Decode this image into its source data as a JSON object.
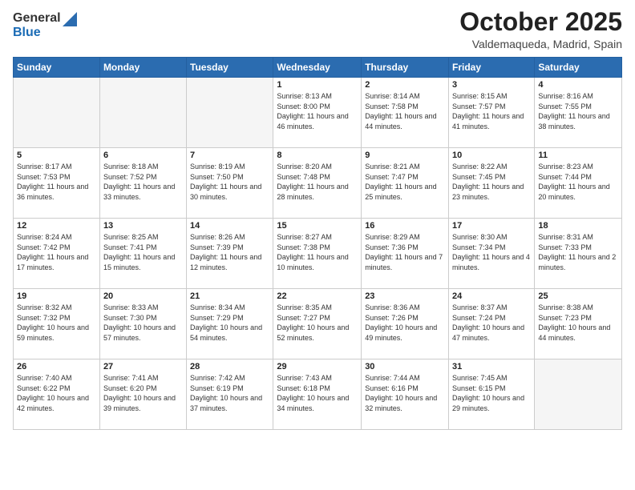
{
  "logo": {
    "general": "General",
    "blue": "Blue"
  },
  "header": {
    "month": "October 2025",
    "location": "Valdemaqueda, Madrid, Spain"
  },
  "weekdays": [
    "Sunday",
    "Monday",
    "Tuesday",
    "Wednesday",
    "Thursday",
    "Friday",
    "Saturday"
  ],
  "weeks": [
    [
      {
        "day": "",
        "info": ""
      },
      {
        "day": "",
        "info": ""
      },
      {
        "day": "",
        "info": ""
      },
      {
        "day": "1",
        "info": "Sunrise: 8:13 AM\nSunset: 8:00 PM\nDaylight: 11 hours and 46 minutes."
      },
      {
        "day": "2",
        "info": "Sunrise: 8:14 AM\nSunset: 7:58 PM\nDaylight: 11 hours and 44 minutes."
      },
      {
        "day": "3",
        "info": "Sunrise: 8:15 AM\nSunset: 7:57 PM\nDaylight: 11 hours and 41 minutes."
      },
      {
        "day": "4",
        "info": "Sunrise: 8:16 AM\nSunset: 7:55 PM\nDaylight: 11 hours and 38 minutes."
      }
    ],
    [
      {
        "day": "5",
        "info": "Sunrise: 8:17 AM\nSunset: 7:53 PM\nDaylight: 11 hours and 36 minutes."
      },
      {
        "day": "6",
        "info": "Sunrise: 8:18 AM\nSunset: 7:52 PM\nDaylight: 11 hours and 33 minutes."
      },
      {
        "day": "7",
        "info": "Sunrise: 8:19 AM\nSunset: 7:50 PM\nDaylight: 11 hours and 30 minutes."
      },
      {
        "day": "8",
        "info": "Sunrise: 8:20 AM\nSunset: 7:48 PM\nDaylight: 11 hours and 28 minutes."
      },
      {
        "day": "9",
        "info": "Sunrise: 8:21 AM\nSunset: 7:47 PM\nDaylight: 11 hours and 25 minutes."
      },
      {
        "day": "10",
        "info": "Sunrise: 8:22 AM\nSunset: 7:45 PM\nDaylight: 11 hours and 23 minutes."
      },
      {
        "day": "11",
        "info": "Sunrise: 8:23 AM\nSunset: 7:44 PM\nDaylight: 11 hours and 20 minutes."
      }
    ],
    [
      {
        "day": "12",
        "info": "Sunrise: 8:24 AM\nSunset: 7:42 PM\nDaylight: 11 hours and 17 minutes."
      },
      {
        "day": "13",
        "info": "Sunrise: 8:25 AM\nSunset: 7:41 PM\nDaylight: 11 hours and 15 minutes."
      },
      {
        "day": "14",
        "info": "Sunrise: 8:26 AM\nSunset: 7:39 PM\nDaylight: 11 hours and 12 minutes."
      },
      {
        "day": "15",
        "info": "Sunrise: 8:27 AM\nSunset: 7:38 PM\nDaylight: 11 hours and 10 minutes."
      },
      {
        "day": "16",
        "info": "Sunrise: 8:29 AM\nSunset: 7:36 PM\nDaylight: 11 hours and 7 minutes."
      },
      {
        "day": "17",
        "info": "Sunrise: 8:30 AM\nSunset: 7:34 PM\nDaylight: 11 hours and 4 minutes."
      },
      {
        "day": "18",
        "info": "Sunrise: 8:31 AM\nSunset: 7:33 PM\nDaylight: 11 hours and 2 minutes."
      }
    ],
    [
      {
        "day": "19",
        "info": "Sunrise: 8:32 AM\nSunset: 7:32 PM\nDaylight: 10 hours and 59 minutes."
      },
      {
        "day": "20",
        "info": "Sunrise: 8:33 AM\nSunset: 7:30 PM\nDaylight: 10 hours and 57 minutes."
      },
      {
        "day": "21",
        "info": "Sunrise: 8:34 AM\nSunset: 7:29 PM\nDaylight: 10 hours and 54 minutes."
      },
      {
        "day": "22",
        "info": "Sunrise: 8:35 AM\nSunset: 7:27 PM\nDaylight: 10 hours and 52 minutes."
      },
      {
        "day": "23",
        "info": "Sunrise: 8:36 AM\nSunset: 7:26 PM\nDaylight: 10 hours and 49 minutes."
      },
      {
        "day": "24",
        "info": "Sunrise: 8:37 AM\nSunset: 7:24 PM\nDaylight: 10 hours and 47 minutes."
      },
      {
        "day": "25",
        "info": "Sunrise: 8:38 AM\nSunset: 7:23 PM\nDaylight: 10 hours and 44 minutes."
      }
    ],
    [
      {
        "day": "26",
        "info": "Sunrise: 7:40 AM\nSunset: 6:22 PM\nDaylight: 10 hours and 42 minutes."
      },
      {
        "day": "27",
        "info": "Sunrise: 7:41 AM\nSunset: 6:20 PM\nDaylight: 10 hours and 39 minutes."
      },
      {
        "day": "28",
        "info": "Sunrise: 7:42 AM\nSunset: 6:19 PM\nDaylight: 10 hours and 37 minutes."
      },
      {
        "day": "29",
        "info": "Sunrise: 7:43 AM\nSunset: 6:18 PM\nDaylight: 10 hours and 34 minutes."
      },
      {
        "day": "30",
        "info": "Sunrise: 7:44 AM\nSunset: 6:16 PM\nDaylight: 10 hours and 32 minutes."
      },
      {
        "day": "31",
        "info": "Sunrise: 7:45 AM\nSunset: 6:15 PM\nDaylight: 10 hours and 29 minutes."
      },
      {
        "day": "",
        "info": ""
      }
    ]
  ]
}
